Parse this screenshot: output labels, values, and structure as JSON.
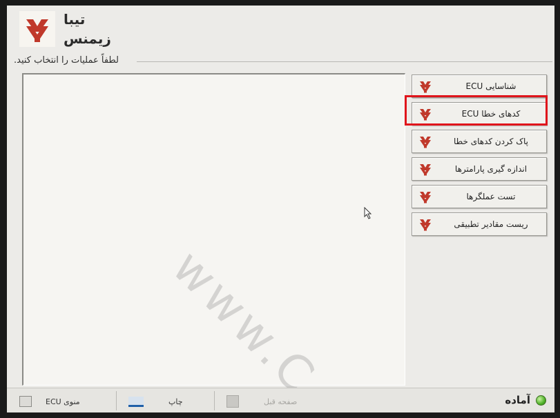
{
  "header": {
    "title_line1": "تیبا",
    "title_line2": "زیمنس",
    "logo_icon": "saipa-logo-icon"
  },
  "group": {
    "label": "لطفاً عملیات را انتخاب کنید."
  },
  "menu": {
    "items": [
      {
        "label": "شناسایی ECU",
        "icon": "saipa-logo-icon"
      },
      {
        "label": "کدهای خطا ECU",
        "icon": "saipa-logo-icon",
        "highlighted": true
      },
      {
        "label": "پاک کردن کدهای خطا",
        "icon": "saipa-logo-icon"
      },
      {
        "label": "اندازه گیری پارامترها",
        "icon": "saipa-logo-icon"
      },
      {
        "label": "تست عملگرها",
        "icon": "saipa-logo-icon"
      },
      {
        "label": "ریست مقادیر تطبیقی",
        "icon": "saipa-logo-icon"
      }
    ]
  },
  "statusbar": {
    "ecu_menu_label": "منوی ECU",
    "print_label": "چاپ",
    "prev_page_label": "صفحه قبل",
    "status_text": "آماده"
  },
  "watermark": {
    "text": "www.C"
  },
  "colors": {
    "logo_red": "#c0392b",
    "highlight_red": "#e0141b",
    "status_green": "#4fb129"
  }
}
